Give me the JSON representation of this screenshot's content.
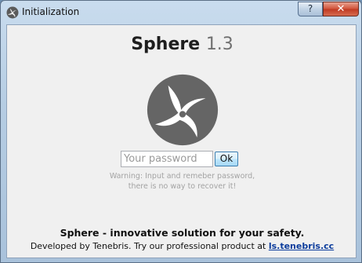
{
  "window": {
    "title": "Initialization",
    "help_label": "?",
    "close_label": "✕"
  },
  "app": {
    "name": "Sphere",
    "version": "1.3"
  },
  "password": {
    "placeholder": "Your password",
    "value": ""
  },
  "ok_label": "Ok",
  "warning": {
    "line1": "Warning: Input and remeber password,",
    "line2": "there is no way to recover it!"
  },
  "tagline": "Sphere - innovative solution for your safety.",
  "footer": {
    "text": "Developed by Tenebris. Try our professional product at",
    "link_label": "ls.tenebris.cc"
  },
  "colors": {
    "logo": "#656565",
    "link": "#0b3c9c",
    "close_button": "#c9422b"
  },
  "icons": {
    "app": "sphere-logo-icon",
    "logo": "sphere-logo-icon"
  }
}
